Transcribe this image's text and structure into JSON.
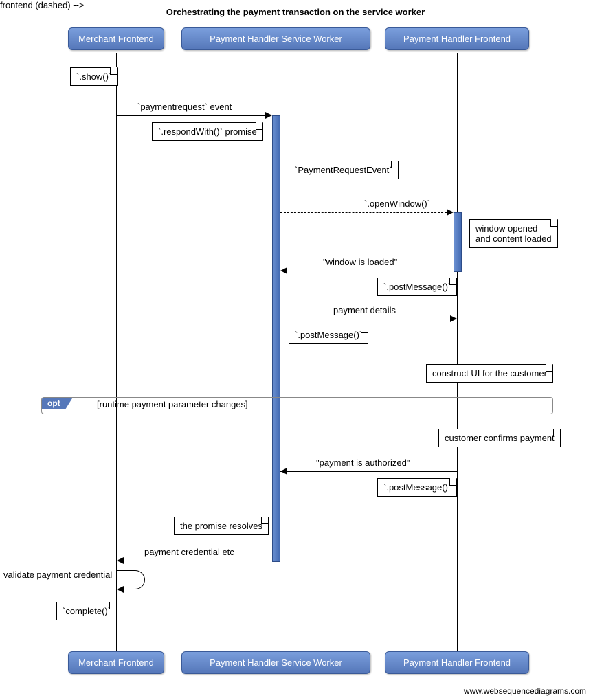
{
  "title": "Orchestrating the payment transaction on the service worker",
  "actors": {
    "merchant": "Merchant Frontend",
    "sw": "Payment Handler Service Worker",
    "frontend": "Payment Handler Frontend"
  },
  "notes": {
    "show": "`.show()`",
    "respondWith": "`.respondWith()` promise",
    "paymentRequestEvent": "`PaymentRequestEvent`",
    "windowOpened1": "window opened",
    "windowOpened2": "and content loaded",
    "postMessage1": "`.postMessage()`",
    "postMessage2": "`.postMessage()`",
    "constructUi": "construct UI for the customer",
    "customerConfirms": "customer confirms payment",
    "postMessage3": "`.postMessage()`",
    "promiseResolves": "the promise resolves",
    "complete": "`complete()`"
  },
  "messages": {
    "paymentrequest": "`paymentrequest` event",
    "openWindow": "`.openWindow()`",
    "windowLoaded": "\"window is loaded\"",
    "paymentDetails": "payment details",
    "paymentAuthorized": "\"payment is authorized\"",
    "paymentCredential": "payment credential etc",
    "validate": "validate payment credential"
  },
  "opt": {
    "label": "opt",
    "condition": "[runtime payment parameter changes]"
  },
  "footer": "www.websequencediagrams.com"
}
